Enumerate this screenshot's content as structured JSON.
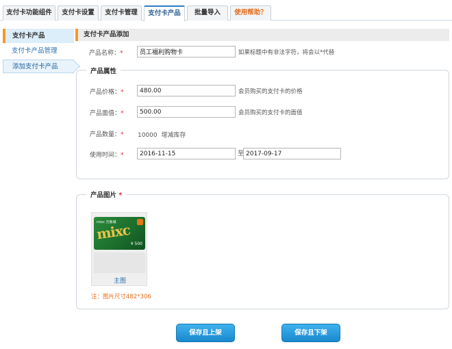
{
  "tabs": [
    {
      "label": "支付卡功能组件"
    },
    {
      "label": "支付卡设置"
    },
    {
      "label": "支付卡管理"
    },
    {
      "label": "支付卡产品"
    },
    {
      "label": "批量导入"
    },
    {
      "label": "使用帮助？"
    }
  ],
  "sidebar": {
    "heading": "支付卡产品",
    "items": [
      {
        "label": "支付卡产品管理"
      },
      {
        "label": "添加支付卡产品"
      }
    ]
  },
  "section_title": "支付卡产品添加",
  "form": {
    "name": {
      "label": "产品名称：",
      "required": "*",
      "value": "员工福利购物卡",
      "hint": "如果标题中有非法字符，将会以*代替"
    },
    "attributes_legend": "产品属性",
    "price": {
      "label": "产品价格：",
      "required": "*",
      "value": "480.00",
      "hint": "会员购买的支付卡的价格"
    },
    "face": {
      "label": "产品面值：",
      "required": "*",
      "value": "500.00",
      "hint": "会员购买的支付卡的面值"
    },
    "quantity": {
      "label": "产品数量：",
      "required": "*",
      "value": "10000",
      "hint": "增减库存"
    },
    "period": {
      "label": "使用时间：",
      "required": "*",
      "start": "2016-11-15",
      "separator": "至",
      "end": "2017-09-17"
    },
    "image_legend": "产品图片",
    "image_required": "*",
    "image_card": {
      "caption": "主图",
      "img_text": "mixc",
      "img_small": "mixc 万象城",
      "img_amount": "¥ 500"
    },
    "image_note": "注：图片尺寸482*306"
  },
  "buttons": {
    "save_on": "保存且上架",
    "save_off": "保存且下架"
  },
  "colors": {
    "accent": "#f29b2a",
    "primary": "#1a88cf",
    "link": "#2a6fb0",
    "warn": "#e06d1a"
  }
}
